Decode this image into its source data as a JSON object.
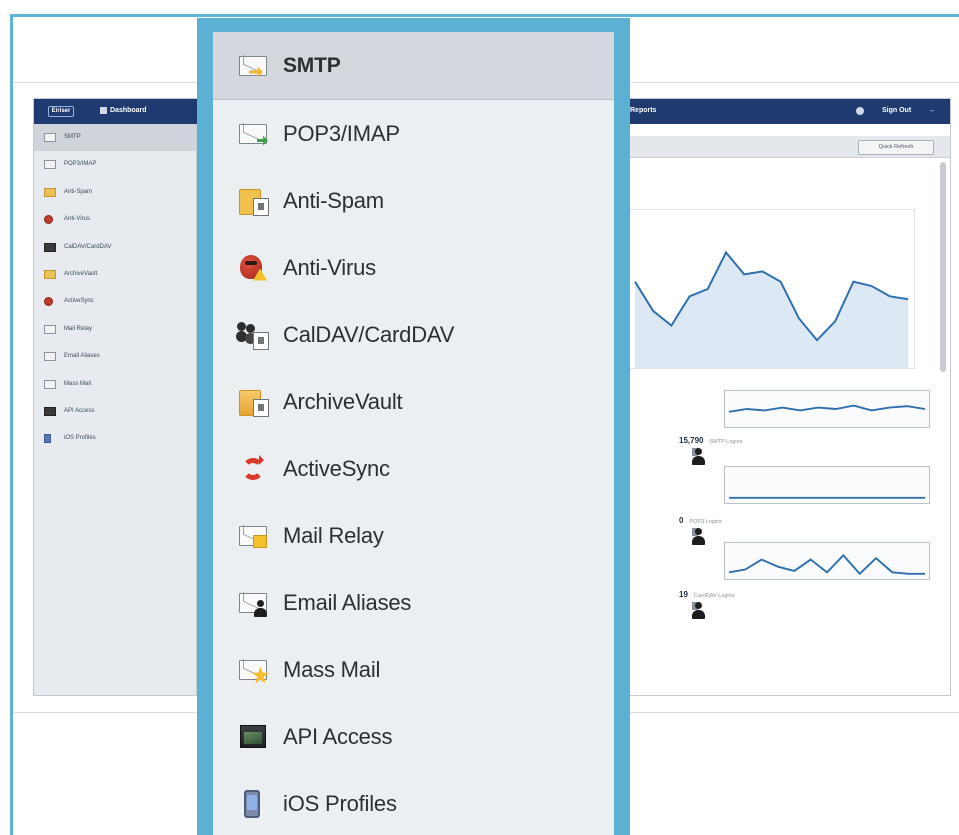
{
  "colors": {
    "frame_border": "#5fb3d6",
    "panel_background": "#eceff2",
    "selected_row": "#d4d8de",
    "topbar": "#1f3a6e",
    "chart_line": "#2f6fb0"
  },
  "background_app": {
    "topbar": {
      "logo": "Eiriser",
      "dashboard": "Dashboard",
      "center_item": "Reports",
      "sign_out": "Sign Out"
    },
    "quick_button": "Quick Refresh",
    "sidebar": [
      {
        "label": "SMTP",
        "icon": "smtp-envelope-icon"
      },
      {
        "label": "POP3/IMAP",
        "icon": "pop3-envelope-icon"
      },
      {
        "label": "Anti-Spam",
        "icon": "folder-icon"
      },
      {
        "label": "Anti-Virus",
        "icon": "bug-icon"
      },
      {
        "label": "CalDAV/CardDAV",
        "icon": "contacts-icon"
      },
      {
        "label": "ArchiveVault",
        "icon": "archive-icon"
      },
      {
        "label": "ActiveSync",
        "icon": "sync-icon"
      },
      {
        "label": "Mail Relay",
        "icon": "relay-icon"
      },
      {
        "label": "Email Aliases",
        "icon": "alias-icon"
      },
      {
        "label": "Mass Mail",
        "icon": "mass-mail-icon"
      },
      {
        "label": "API Access",
        "icon": "terminal-icon"
      },
      {
        "label": "iOS Profiles",
        "icon": "phone-icon"
      }
    ],
    "stats": [
      {
        "value": "15,790",
        "label": "SMTP Logins"
      },
      {
        "value": "0",
        "label": "POP3 Logins"
      },
      {
        "value": "19",
        "label": "CardDAV Logins"
      }
    ],
    "big_chart_trend": [
      0.55,
      0.35,
      0.25,
      0.45,
      0.5,
      0.75,
      0.6,
      0.62,
      0.55,
      0.3,
      0.15,
      0.28,
      0.55,
      0.52,
      0.45,
      0.43
    ],
    "mini_charts": [
      [
        0.4,
        0.5,
        0.45,
        0.55,
        0.45,
        0.55,
        0.5,
        0.62,
        0.45,
        0.55,
        0.6,
        0.5
      ],
      [
        0.05,
        0.05,
        0.05,
        0.05,
        0.05,
        0.05,
        0.05,
        0.05,
        0.05,
        0.05
      ],
      [
        0.1,
        0.2,
        0.55,
        0.3,
        0.15,
        0.55,
        0.1,
        0.7,
        0.05,
        0.6,
        0.1,
        0.05,
        0.05
      ]
    ]
  },
  "menu": {
    "items": [
      {
        "label": "SMTP",
        "icon": "smtp-icon",
        "selected": true
      },
      {
        "label": "POP3/IMAP",
        "icon": "pop3-imap-icon",
        "selected": false
      },
      {
        "label": "Anti-Spam",
        "icon": "anti-spam-icon",
        "selected": false
      },
      {
        "label": "Anti-Virus",
        "icon": "anti-virus-icon",
        "selected": false
      },
      {
        "label": "CalDAV/CardDAV",
        "icon": "caldav-carddav-icon",
        "selected": false
      },
      {
        "label": "ArchiveVault",
        "icon": "archive-vault-icon",
        "selected": false
      },
      {
        "label": "ActiveSync",
        "icon": "active-sync-icon",
        "selected": false
      },
      {
        "label": "Mail Relay",
        "icon": "mail-relay-icon",
        "selected": false
      },
      {
        "label": "Email Aliases",
        "icon": "email-aliases-icon",
        "selected": false
      },
      {
        "label": "Mass Mail",
        "icon": "mass-mail-icon",
        "selected": false
      },
      {
        "label": "API Access",
        "icon": "api-access-icon",
        "selected": false
      },
      {
        "label": "iOS Profiles",
        "icon": "ios-profiles-icon",
        "selected": false
      }
    ]
  }
}
